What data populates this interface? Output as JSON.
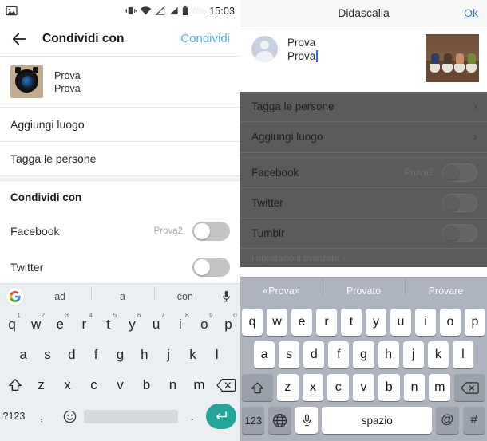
{
  "android": {
    "status_bar": {
      "time": "15:03",
      "battery_pct": "70%",
      "icons": [
        "image-icon",
        "vibrate-icon",
        "wifi-icon",
        "signal-1-icon",
        "signal-2-icon",
        "battery-icon"
      ]
    },
    "header": {
      "back_icon": "back-arrow-icon",
      "title": "Condividi con",
      "action": "Condividi",
      "action_color": "#5bb0ea"
    },
    "post": {
      "line1": "Prova",
      "line2": "Prova"
    },
    "rows": [
      {
        "label": "Aggiungi luogo"
      },
      {
        "label": "Tagga le persone"
      }
    ],
    "section_title": "Condividi con",
    "toggles": [
      {
        "label": "Facebook",
        "account": "Prova2",
        "on": false
      },
      {
        "label": "Twitter",
        "account": "",
        "on": false
      }
    ],
    "keyboard": {
      "suggestions": [
        "ad",
        "a",
        "con"
      ],
      "logo_icon": "google-g-icon",
      "mic_icon": "microphone-icon",
      "row1": [
        {
          "k": "q",
          "n": "1"
        },
        {
          "k": "w",
          "n": "2"
        },
        {
          "k": "e",
          "n": "3"
        },
        {
          "k": "r",
          "n": "4"
        },
        {
          "k": "t",
          "n": "5"
        },
        {
          "k": "y",
          "n": "6"
        },
        {
          "k": "u",
          "n": "7"
        },
        {
          "k": "i",
          "n": "8"
        },
        {
          "k": "o",
          "n": "9"
        },
        {
          "k": "p",
          "n": "0"
        }
      ],
      "row2": [
        "a",
        "s",
        "d",
        "f",
        "g",
        "h",
        "j",
        "k",
        "l"
      ],
      "row3": [
        "z",
        "x",
        "c",
        "v",
        "b",
        "n",
        "m"
      ],
      "shift_icon": "shift-up-icon",
      "backspace_icon": "backspace-icon",
      "sym_key": "?123",
      "comma_key": ",",
      "emoji_icon": "smiley-icon",
      "period_key": ".",
      "enter_icon": "enter-icon",
      "enter_color": "#25a59a"
    }
  },
  "ios": {
    "header": {
      "title": "Didascalia",
      "action": "Ok",
      "action_color": "#3a7fc1"
    },
    "caption": {
      "line1": "Prova",
      "line2": "Prova",
      "avatar_icon": "avatar-placeholder-icon",
      "photo_icon": "photo-thumbnail"
    },
    "rows": [
      {
        "label": "Tagga le persone",
        "chevron": "›"
      },
      {
        "label": "Aggiungi luogo",
        "chevron": "›"
      }
    ],
    "toggles": [
      {
        "label": "Facebook",
        "account": "Prova2",
        "on": false
      },
      {
        "label": "Twitter",
        "account": "",
        "on": false
      },
      {
        "label": "Tumblr",
        "account": "",
        "on": false
      }
    ],
    "advanced": {
      "label": "Impostazioni avanzate",
      "chevron": "›"
    },
    "keyboard": {
      "suggestions": [
        "«Prova»",
        "Provato",
        "Provare"
      ],
      "row1": [
        "q",
        "w",
        "e",
        "r",
        "t",
        "y",
        "u",
        "i",
        "o",
        "p"
      ],
      "row2": [
        "a",
        "s",
        "d",
        "f",
        "g",
        "h",
        "j",
        "k",
        "l"
      ],
      "row3": [
        "z",
        "x",
        "c",
        "v",
        "b",
        "n",
        "m"
      ],
      "shift_icon": "shift-up-icon",
      "backspace_icon": "backspace-icon",
      "num_key": "123",
      "globe_icon": "globe-icon",
      "mic_icon": "microphone-icon",
      "space_key": "spazio",
      "at_key": "@",
      "hash_key": "#"
    }
  }
}
